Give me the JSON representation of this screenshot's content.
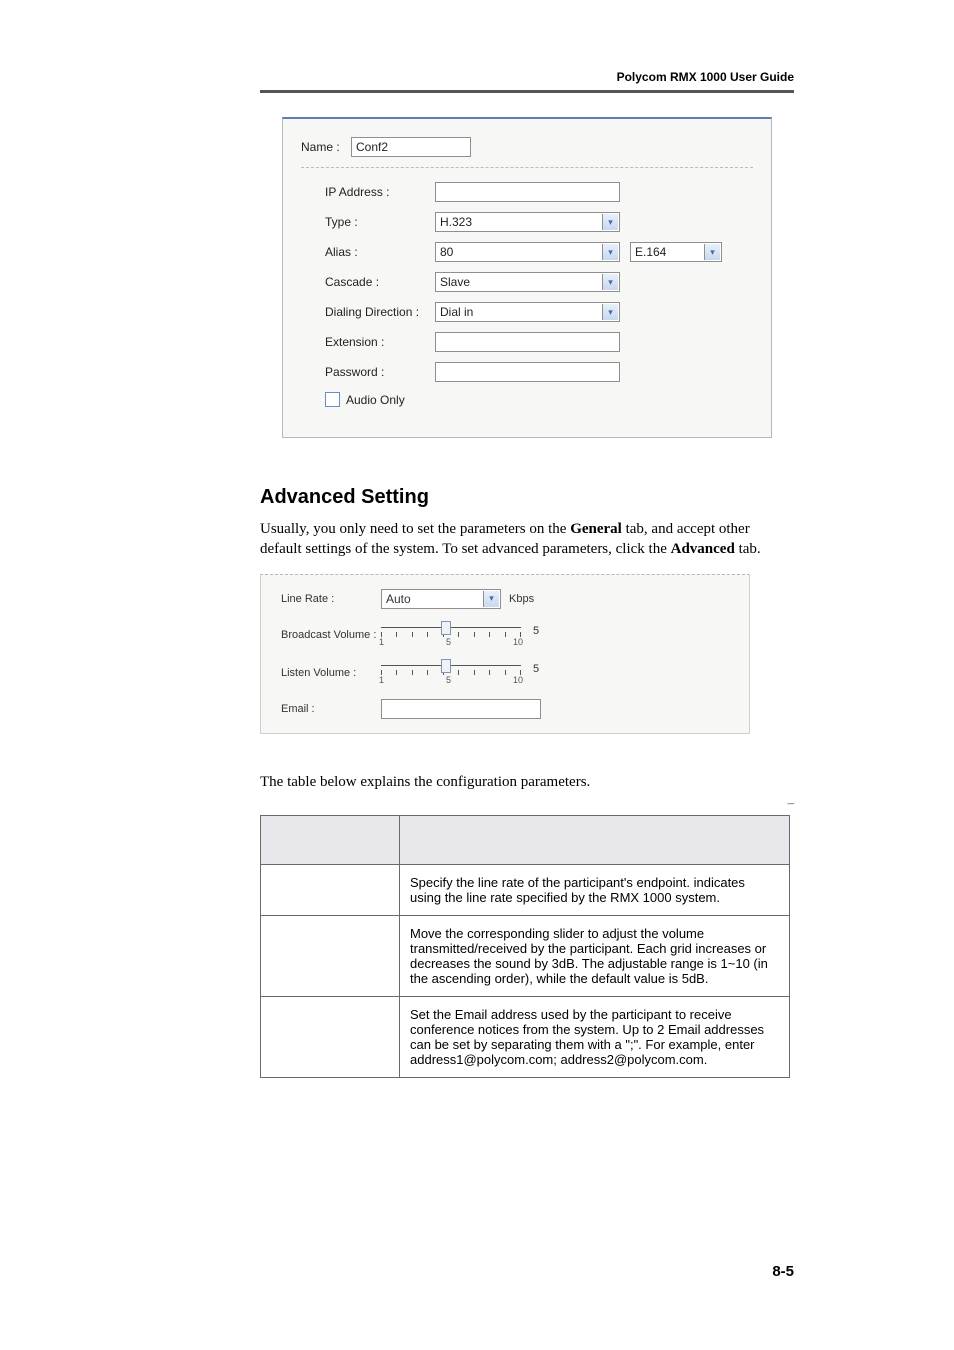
{
  "header": {
    "title": "Polycom RMX 1000 User Guide"
  },
  "shot1": {
    "name_label": "Name :",
    "name_value": "Conf2",
    "rows": {
      "ip_label": "IP Address :",
      "ip_value": "",
      "type_label": "Type :",
      "type_value": "H.323",
      "alias_label": "Alias :",
      "alias_value": "80",
      "alias_type_value": "E.164",
      "cascade_label": "Cascade :",
      "cascade_value": "Slave",
      "dialdir_label": "Dialing Direction :",
      "dialdir_value": "Dial in",
      "ext_label": "Extension :",
      "ext_value": "",
      "pwd_label": "Password :",
      "pwd_value": "",
      "audio_only_label": "Audio Only"
    }
  },
  "section": {
    "title": "Advanced Setting",
    "para1_a": "Usually, you only need to set the parameters on the ",
    "para1_b": "General",
    "para1_c": " tab, and accept other default settings of the system. To set advanced parameters, click the ",
    "para1_d": "Advanced",
    "para1_e": " tab."
  },
  "shot2": {
    "linerate_label": "Line Rate :",
    "linerate_value": "Auto",
    "linerate_unit": "Kbps",
    "broadcast_label": "Broadcast Volume :",
    "broadcast_value": "5",
    "listen_label": "Listen Volume :",
    "listen_value": "5",
    "email_label": "Email :",
    "email_value": "",
    "slider_min": "1",
    "slider_mid": "5",
    "slider_max": "10"
  },
  "table": {
    "intro": "The table below explains the configuration parameters.",
    "caption_left": "",
    "caption_right": "–",
    "head_param": "",
    "head_desc": "",
    "rows": [
      {
        "param": "",
        "desc": "Specify the line rate of the participant's endpoint.            indicates using the line rate specified by the RMX 1000 system."
      },
      {
        "param": "",
        "desc": "Move the corresponding slider to adjust the volume transmitted/received by the participant. Each grid increases or decreases the sound by 3dB. The adjustable range is 1~10 (in the ascending order), while the default value is 5dB."
      },
      {
        "param": "",
        "desc": "Set the Email address used by the participant to receive conference notices from the system. Up to 2 Email addresses can be set by separating them with a \";\". For example, enter address1@polycom.com; address2@polycom.com."
      }
    ]
  },
  "page_number": "8-5"
}
